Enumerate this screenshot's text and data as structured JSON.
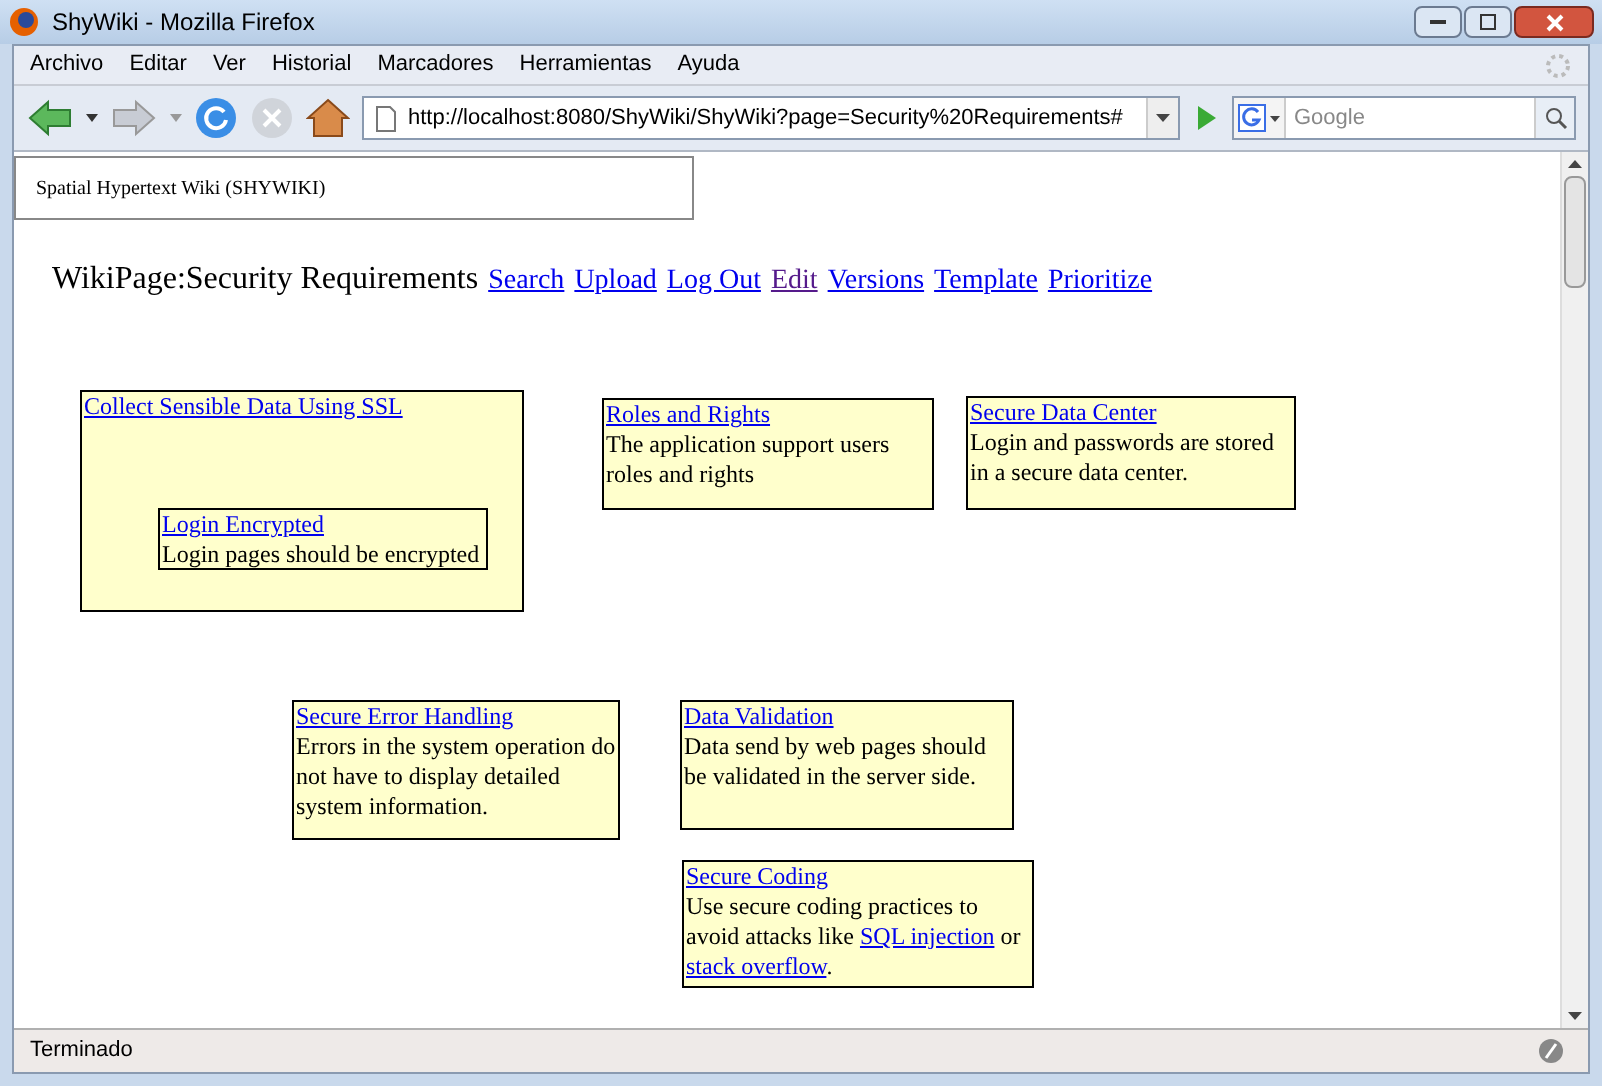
{
  "window": {
    "title": "ShyWiki - Mozilla Firefox"
  },
  "menu": [
    "Archivo",
    "Editar",
    "Ver",
    "Historial",
    "Marcadores",
    "Herramientas",
    "Ayuda"
  ],
  "address": {
    "value": "http://localhost:8080/ShyWiki/ShyWiki?page=Security%20Requirements#"
  },
  "search": {
    "placeholder": "Google"
  },
  "header_box": {
    "text": "Spatial Hypertext Wiki (SHYWIKI)"
  },
  "page_title": "WikiPage:Security Requirements",
  "nav_links": [
    {
      "label": "Search",
      "visited": false
    },
    {
      "label": "Upload",
      "visited": false
    },
    {
      "label": "Log Out",
      "visited": false
    },
    {
      "label": "Edit",
      "visited": true
    },
    {
      "label": "Versions",
      "visited": false
    },
    {
      "label": "Template",
      "visited": false
    },
    {
      "label": "Prioritize",
      "visited": false
    }
  ],
  "cards": [
    {
      "title": "Collect Sensible Data Using SSL",
      "children": [
        {
          "title": "Login Encrypted",
          "body": [
            {
              "kind": "text",
              "text": "Login pages should be encrypted"
            }
          ]
        }
      ]
    },
    {
      "title": "Roles and Rights",
      "body": [
        {
          "kind": "text",
          "text": "The application support users roles and rights"
        }
      ]
    },
    {
      "title": "Secure Data Center",
      "body": [
        {
          "kind": "text",
          "text": "Login and passwords are stored in a secure data center."
        }
      ]
    },
    {
      "title": "Secure Error Handling",
      "body": [
        {
          "kind": "text",
          "text": "Errors in the system operation do not have to display detailed system information."
        }
      ]
    },
    {
      "title": "Data Validation",
      "body": [
        {
          "kind": "text",
          "text": "Data send by web pages should be validated in the server side."
        }
      ]
    },
    {
      "title": "Secure Coding",
      "body": [
        {
          "kind": "text",
          "text": "Use secure coding practices to avoid attacks like "
        },
        {
          "kind": "link",
          "text": "SQL injection"
        },
        {
          "kind": "text",
          "text": " or "
        },
        {
          "kind": "link",
          "text": "stack overflow"
        },
        {
          "kind": "text",
          "text": "."
        }
      ]
    }
  ],
  "status_bar": {
    "text": "Terminado"
  }
}
